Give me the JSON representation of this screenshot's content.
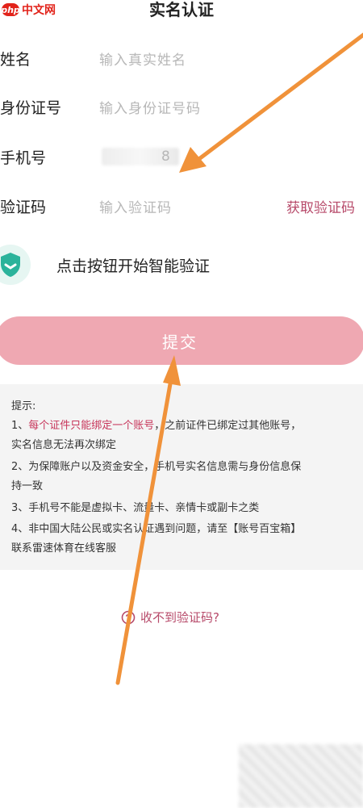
{
  "watermark": {
    "logo": "php",
    "text": "中文网"
  },
  "header": {
    "title": "实名认证"
  },
  "form": {
    "name": {
      "label": "姓名",
      "placeholder": "输入真实姓名"
    },
    "id_number": {
      "label": "身份证号",
      "placeholder": "输入身份证号码"
    },
    "phone": {
      "label": "手机号",
      "value_tail": "8"
    },
    "code": {
      "label": "验证码",
      "placeholder": "输入验证码",
      "get_code": "获取验证码"
    }
  },
  "verify": {
    "text": "点击按钮开始智能验证",
    "icon": "shield-check-icon"
  },
  "submit": {
    "label": "提交"
  },
  "tips": {
    "title": "提示:",
    "line1_a": "1、",
    "line1_hl": "每个证件只能绑定一个账号",
    "line1_b": "，之前证件已绑定过其他账号，",
    "line1_c": "实名信息无法再次绑定",
    "line2_a": "2、为保障账户以及资金安全，手机号实名信息需与身份信息保",
    "line2_b": "持一致",
    "line3": "3、手机号不能是虚拟卡、流量卡、亲情卡或副卡之类",
    "line4_a": "4、非中国大陆公民或实名认证遇到问题，请至【账号百宝箱】",
    "line4_b": "联系雷速体育在线客服"
  },
  "help": {
    "text": "收不到验证码?",
    "icon": "question-circle-icon"
  },
  "colors": {
    "accent": "#b74a6a",
    "submit_bg": "#efa8b2",
    "arrow": "#f0923a",
    "shield": "#2bb39b"
  }
}
